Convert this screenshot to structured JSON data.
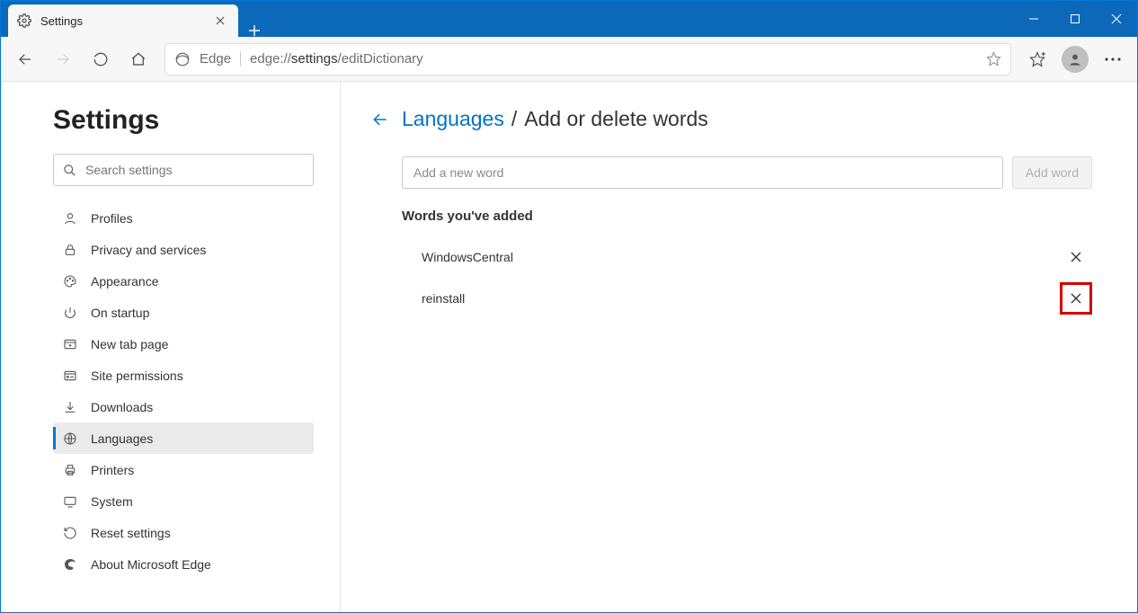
{
  "tab": {
    "title": "Settings"
  },
  "address": {
    "scheme_label": "Edge",
    "url_prefix": "edge://",
    "url_dark": "settings",
    "url_suffix": "/editDictionary"
  },
  "sidebar": {
    "heading": "Settings",
    "search_placeholder": "Search settings",
    "items": [
      {
        "label": "Profiles"
      },
      {
        "label": "Privacy and services"
      },
      {
        "label": "Appearance"
      },
      {
        "label": "On startup"
      },
      {
        "label": "New tab page"
      },
      {
        "label": "Site permissions"
      },
      {
        "label": "Downloads"
      },
      {
        "label": "Languages"
      },
      {
        "label": "Printers"
      },
      {
        "label": "System"
      },
      {
        "label": "Reset settings"
      },
      {
        "label": "About Microsoft Edge"
      }
    ]
  },
  "main": {
    "breadcrumb_link": "Languages",
    "breadcrumb_sep": "/",
    "breadcrumb_current": "Add or delete words",
    "add_placeholder": "Add a new word",
    "add_button": "Add word",
    "section_title": "Words you've added",
    "words": [
      {
        "text": "WindowsCentral"
      },
      {
        "text": "reinstall"
      }
    ]
  }
}
